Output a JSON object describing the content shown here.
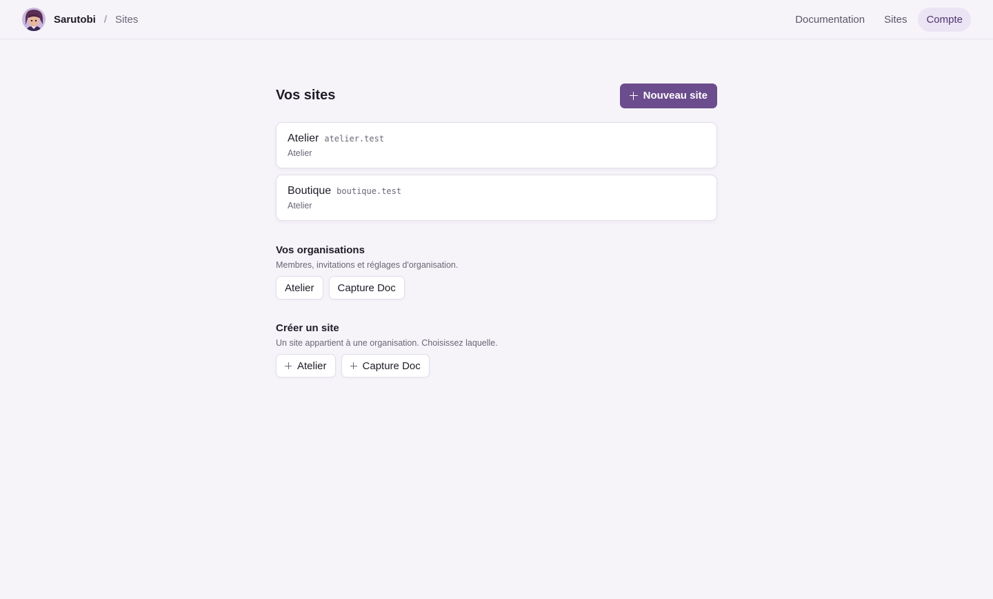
{
  "header": {
    "brand": "Sarutobi",
    "separator": "/",
    "breadcrumb": "Sites",
    "nav": [
      {
        "label": "Documentation",
        "active": false
      },
      {
        "label": "Sites",
        "active": false
      },
      {
        "label": "Compte",
        "active": true
      }
    ]
  },
  "main": {
    "title": "Vos sites",
    "new_site_label": "Nouveau site",
    "sites": [
      {
        "name": "Atelier",
        "domain": "atelier.test",
        "org": "Atelier"
      },
      {
        "name": "Boutique",
        "domain": "boutique.test",
        "org": "Atelier"
      }
    ],
    "organisations": {
      "title": "Vos organisations",
      "description": "Membres, invitations et réglages d'organisation.",
      "items": [
        "Atelier",
        "Capture Doc"
      ]
    },
    "create": {
      "title": "Créer un site",
      "description": "Un site appartient à une organisation. Choisissez laquelle.",
      "items": [
        "Atelier",
        "Capture Doc"
      ]
    }
  },
  "colors": {
    "accent": "#6b4c8c",
    "background": "#f6f4f9",
    "nav_active_bg": "#ebe4f4"
  }
}
